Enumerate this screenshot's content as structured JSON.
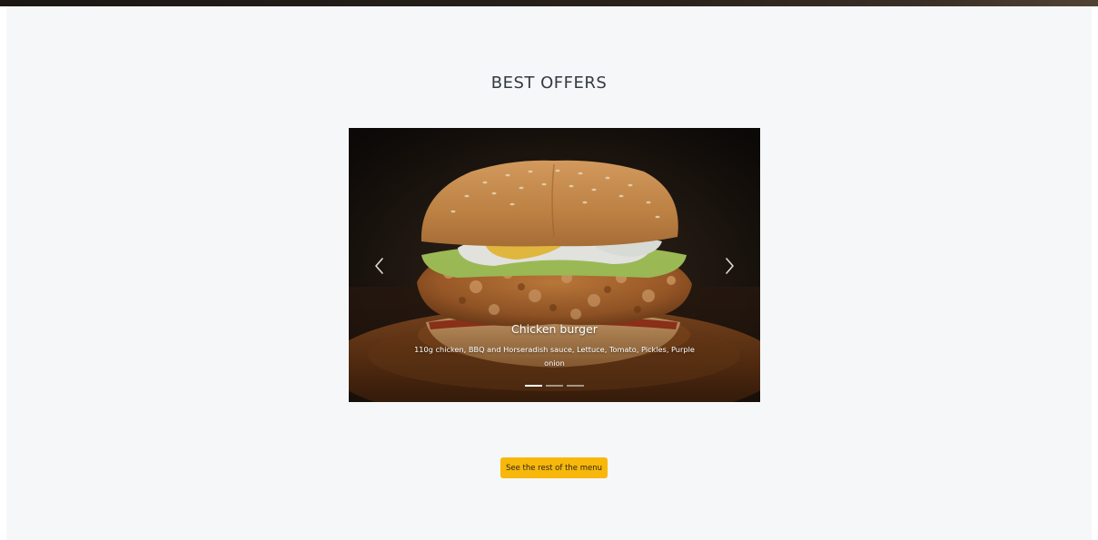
{
  "section": {
    "title": "BEST OFFERS"
  },
  "carousel": {
    "slides": [
      {
        "title": "Chicken burger",
        "description": "110g chicken, BBQ and Horseradish sauce, Lettuce, Tomato, Pickles, Purple onion",
        "image": "chicken-burger-photo"
      }
    ],
    "active_index": 0,
    "slide_count": 3,
    "prev_icon": "chevron-left-icon",
    "next_icon": "chevron-right-icon"
  },
  "cta": {
    "label": "See the rest of the menu"
  },
  "colors": {
    "accent": "#f7b80b",
    "section_bg": "#f6f7f9",
    "title_text": "#333a40"
  }
}
